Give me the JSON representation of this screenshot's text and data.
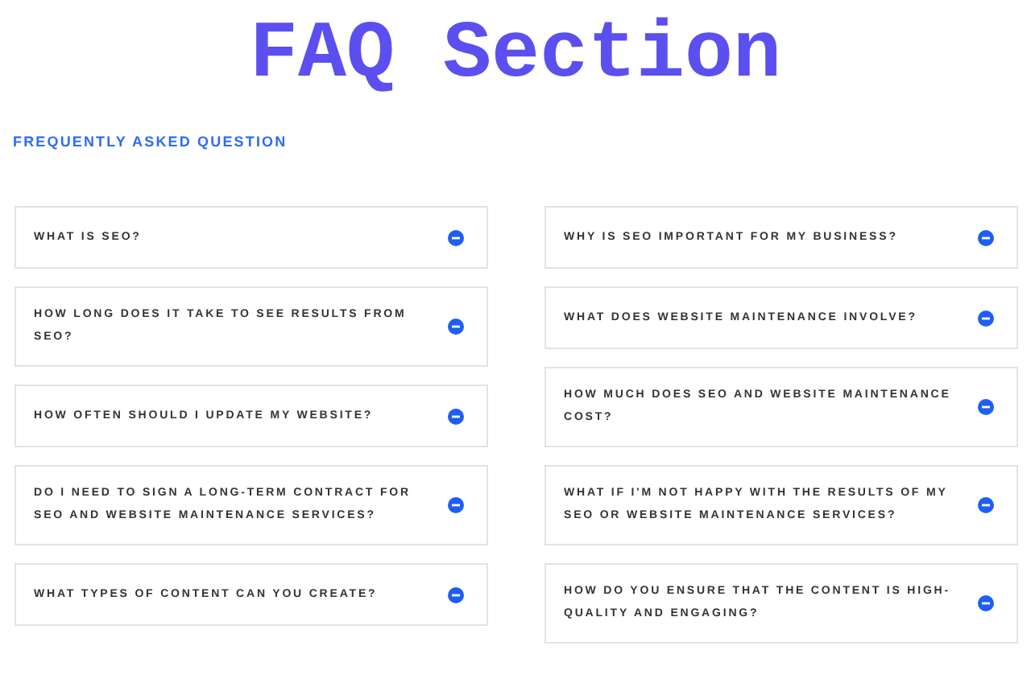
{
  "title": "FAQ Section",
  "subtitle": "FREQUENTLY ASKED QUESTION",
  "columns": [
    [
      {
        "question": "WHAT IS SEO?"
      },
      {
        "question": "HOW LONG DOES IT TAKE TO SEE RESULTS FROM SEO?"
      },
      {
        "question": "HOW OFTEN SHOULD I UPDATE MY WEBSITE?"
      },
      {
        "question": "DO I NEED TO SIGN A LONG-TERM CONTRACT FOR SEO AND WEBSITE MAINTENANCE SERVICES?"
      },
      {
        "question": "WHAT TYPES OF CONTENT CAN YOU CREATE?"
      }
    ],
    [
      {
        "question": "WHY IS SEO IMPORTANT FOR MY BUSINESS?"
      },
      {
        "question": "WHAT DOES WEBSITE MAINTENANCE INVOLVE?"
      },
      {
        "question": "HOW MUCH DOES SEO AND WEBSITE MAINTENANCE COST?"
      },
      {
        "question": "WHAT IF I'M NOT HAPPY WITH THE RESULTS OF MY SEO OR WEBSITE MAINTENANCE SERVICES?"
      },
      {
        "question": "HOW DO YOU ENSURE THAT THE CONTENT IS HIGH-QUALITY AND ENGAGING?"
      }
    ]
  ]
}
